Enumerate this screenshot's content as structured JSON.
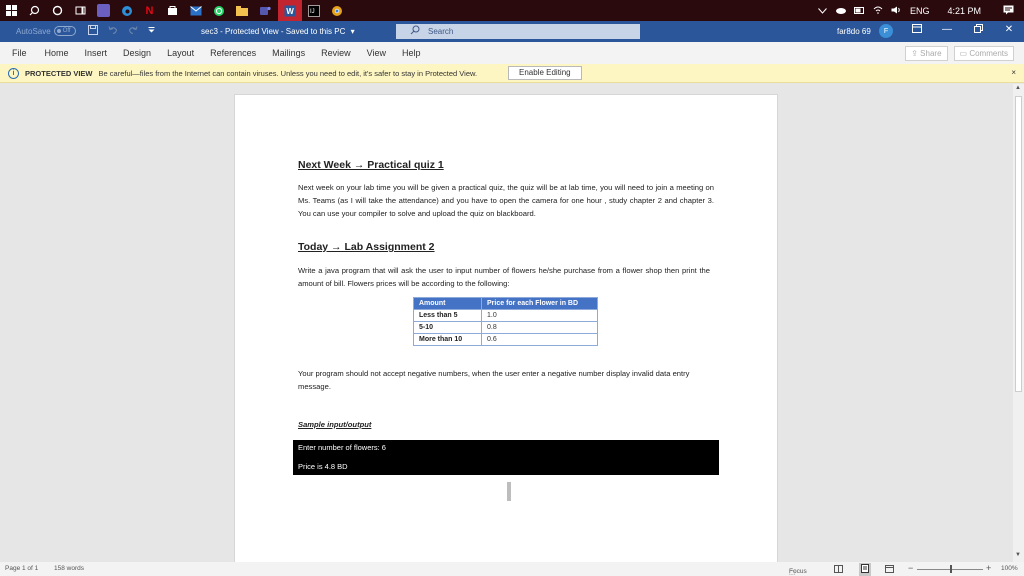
{
  "taskbar": {
    "tray": {
      "language": "ENG",
      "time": "4:21 PM"
    }
  },
  "titlebar": {
    "autosave_label": "AutoSave",
    "autosave_state": "Off",
    "document_title": "sec3 - Protected View - Saved to this PC",
    "search_placeholder": "Search",
    "user_name": "far8do 69",
    "avatar_initial": "F"
  },
  "ribbon": {
    "tabs": [
      "File",
      "Home",
      "Insert",
      "Design",
      "Layout",
      "References",
      "Mailings",
      "Review",
      "View",
      "Help"
    ],
    "share_label": "Share",
    "comments_label": "Comments"
  },
  "protected_bar": {
    "title": "PROTECTED VIEW",
    "message": "Be careful—files from the Internet can contain viruses. Unless you need to edit, it's safer to stay in Protected View.",
    "enable_label": "Enable Editing",
    "close": "×"
  },
  "document": {
    "heading1": "Next Week → Practical quiz 1",
    "para1": "Next week on your lab time you will be given a practical quiz, the quiz will be at lab time, you will need to join a meeting on Ms. Teams (as I will take the attendance) and you have to open the camera for one hour , study chapter 2 and chapter 3. You can use your compiler to solve and upload the quiz on blackboard.",
    "heading2": "Today → Lab Assignment 2",
    "para2": "Write a java program that will ask the user to input number of flowers he/she purchase from a  flower shop then print the amount of bill. Flowers prices will be according to the following:",
    "table": {
      "headers": [
        "Amount",
        "Price for each Flower in BD"
      ],
      "rows": [
        [
          "Less than 5",
          "1.0"
        ],
        [
          "5-10",
          "0.8"
        ],
        [
          "More than 10",
          "0.6"
        ]
      ]
    },
    "para3": "Your program should not accept negative numbers, when the user enter a negative number display invalid data entry message.",
    "sample_heading": "Sample input/output",
    "console_line1": "Enter number of flowers: 6",
    "console_line2": "Price is 4.8 BD"
  },
  "statusbar": {
    "page": "Page 1 of 1",
    "words": "158 words",
    "focus": "Focus",
    "zoom": "100%"
  }
}
